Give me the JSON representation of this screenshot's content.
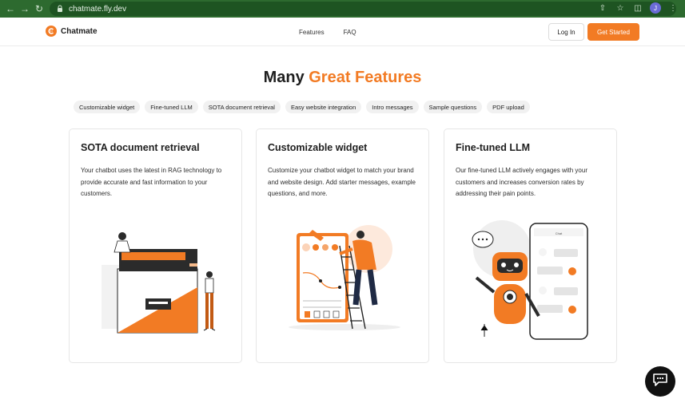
{
  "browser": {
    "url": "chatmate.fly.dev",
    "avatar_initial": "J"
  },
  "header": {
    "brand": "Chatmate",
    "nav": [
      "Features",
      "FAQ"
    ],
    "login_label": "Log In",
    "cta_label": "Get Started"
  },
  "hero": {
    "title_plain": "Many",
    "title_accent": "Great Features"
  },
  "pills": [
    "Customizable widget",
    "Fine-tuned LLM",
    "SOTA document retrieval",
    "Easy website integration",
    "Intro messages",
    "Sample questions",
    "PDF upload"
  ],
  "cards": [
    {
      "title": "SOTA document retrieval",
      "description": "Your chatbot uses the latest in RAG technology to provide accurate and fast information to your customers."
    },
    {
      "title": "Customizable widget",
      "description": "Customize your chatbot widget to match your brand and website design. Add starter messages, example questions, and more."
    },
    {
      "title": "Fine-tuned LLM",
      "description": "Our fine-tuned LLM actively engages with your customers and increases conversion rates by addressing their pain points."
    }
  ],
  "illustrations": {
    "chat_header": "Chat"
  },
  "colors": {
    "accent": "#f27b24",
    "chrome": "#2d6a2f",
    "text": "#1f1f1f"
  },
  "icons": {
    "back": "arrow-left-icon",
    "forward": "arrow-right-icon",
    "reload": "reload-icon",
    "lock": "lock-icon",
    "share": "share-icon",
    "star": "star-icon",
    "sidebar": "sidebar-icon",
    "menu": "more-vert-icon",
    "chat": "chat-bubble-icon"
  }
}
